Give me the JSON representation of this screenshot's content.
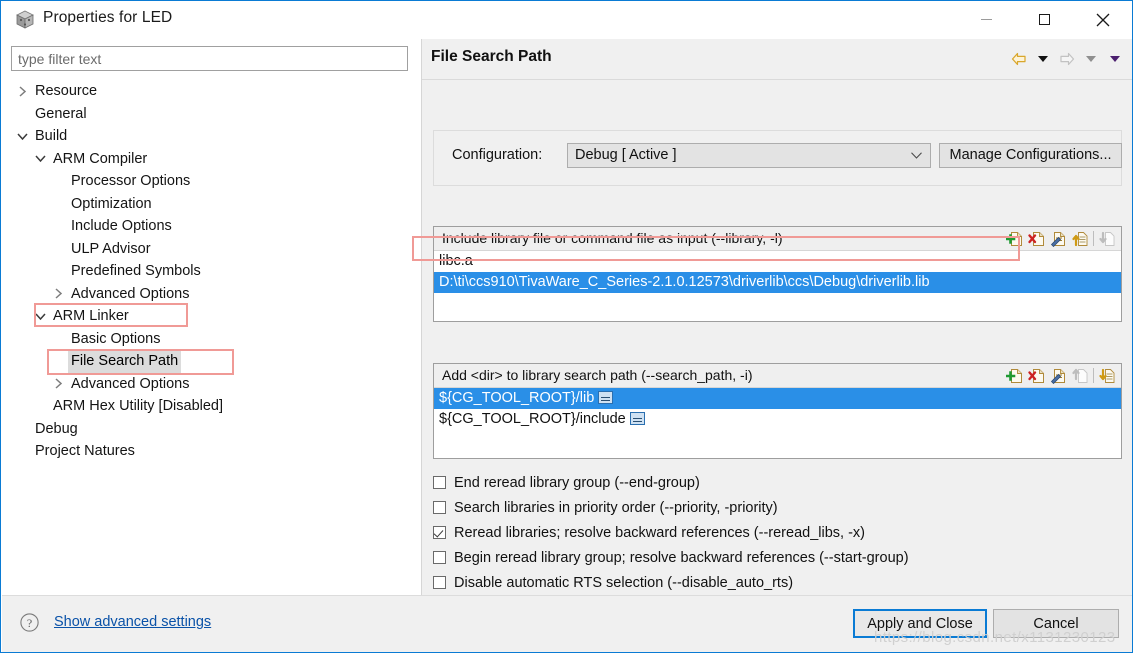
{
  "window": {
    "title": "Properties for LED",
    "icon": "ccs-cube-icon",
    "controls": {
      "minimize": "Minimize",
      "maximize": "Maximize",
      "close": "Close"
    }
  },
  "sidebar": {
    "filter": {
      "placeholder": "type filter text",
      "value": ""
    },
    "items": [
      {
        "label": "Resource",
        "indent": 0,
        "twisty": "collapsed",
        "selected": false
      },
      {
        "label": "General",
        "indent": 0,
        "twisty": "none",
        "selected": false
      },
      {
        "label": "Build",
        "indent": 0,
        "twisty": "expanded",
        "selected": false
      },
      {
        "label": "ARM Compiler",
        "indent": 1,
        "twisty": "expanded",
        "selected": false
      },
      {
        "label": "Processor Options",
        "indent": 2,
        "twisty": "none",
        "selected": false
      },
      {
        "label": "Optimization",
        "indent": 2,
        "twisty": "none",
        "selected": false
      },
      {
        "label": "Include Options",
        "indent": 2,
        "twisty": "none",
        "selected": false
      },
      {
        "label": "ULP Advisor",
        "indent": 2,
        "twisty": "none",
        "selected": false
      },
      {
        "label": "Predefined Symbols",
        "indent": 2,
        "twisty": "none",
        "selected": false
      },
      {
        "label": "Advanced Options",
        "indent": 2,
        "twisty": "collapsed",
        "selected": false
      },
      {
        "label": "ARM Linker",
        "indent": 1,
        "twisty": "expanded",
        "selected": false
      },
      {
        "label": "Basic Options",
        "indent": 2,
        "twisty": "none",
        "selected": false
      },
      {
        "label": "File Search Path",
        "indent": 2,
        "twisty": "none",
        "selected": true
      },
      {
        "label": "Advanced Options",
        "indent": 2,
        "twisty": "collapsed",
        "selected": false
      },
      {
        "label": "ARM Hex Utility  [Disabled]",
        "indent": 1,
        "twisty": "none",
        "selected": false
      },
      {
        "label": "Debug",
        "indent": 0,
        "twisty": "none",
        "selected": false
      },
      {
        "label": "Project Natures",
        "indent": 0,
        "twisty": "none",
        "selected": false
      }
    ]
  },
  "page": {
    "title": "File Search Path",
    "nav": {
      "back": "back-arrow-icon",
      "back_menu": "back-dropdown-icon",
      "forward": "forward-arrow-icon",
      "forward_menu": "forward-dropdown-icon",
      "view_menu": "view-menu-dropdown-icon"
    },
    "configuration": {
      "label": "Configuration:",
      "selected": "Debug  [ Active ]",
      "options": [
        "Debug  [ Active ]"
      ],
      "manage_button": "Manage Configurations..."
    },
    "library_list": {
      "header": "Include library file or command file as input (--library, -l)",
      "tools": [
        "add-icon",
        "delete-icon",
        "edit-icon",
        "move-up-icon",
        "move-down-icon"
      ],
      "rows": [
        {
          "text": "libc.a",
          "selected": false,
          "variable": false
        },
        {
          "text": "D:\\ti\\ccs910\\TivaWare_C_Series-2.1.0.12573\\driverlib\\ccs\\Debug\\driverlib.lib",
          "selected": true,
          "variable": false
        }
      ]
    },
    "search_path_list": {
      "header": "Add <dir> to library search path (--search_path, -i)",
      "tools": [
        "add-icon",
        "delete-icon",
        "edit-icon",
        "move-up-icon",
        "move-down-icon"
      ],
      "rows": [
        {
          "text": "${CG_TOOL_ROOT}/lib",
          "selected": true,
          "variable": true
        },
        {
          "text": "${CG_TOOL_ROOT}/include",
          "selected": false,
          "variable": true
        }
      ]
    },
    "checkboxes": [
      {
        "label": "End reread library group (--end-group)",
        "checked": false
      },
      {
        "label": "Search libraries in priority order (--priority, -priority)",
        "checked": false
      },
      {
        "label": "Reread libraries; resolve backward references (--reread_libs, -x)",
        "checked": true
      },
      {
        "label": "Begin reread library group; resolve backward references (--start-group)",
        "checked": false
      },
      {
        "label": "Disable automatic RTS selection (--disable_auto_rts)",
        "checked": false
      }
    ]
  },
  "footer": {
    "help_icon": "help-question-icon",
    "advanced_link": "Show advanced settings",
    "apply_button": "Apply and Close",
    "cancel_button": "Cancel"
  },
  "watermark": "https://blog.csdn.net/x1131230123",
  "colors": {
    "selection_blue": "#2a8fe7",
    "accent_blue": "#0a7bd4",
    "annotation_red": "#f09a96",
    "link_blue": "#0a52a8"
  }
}
